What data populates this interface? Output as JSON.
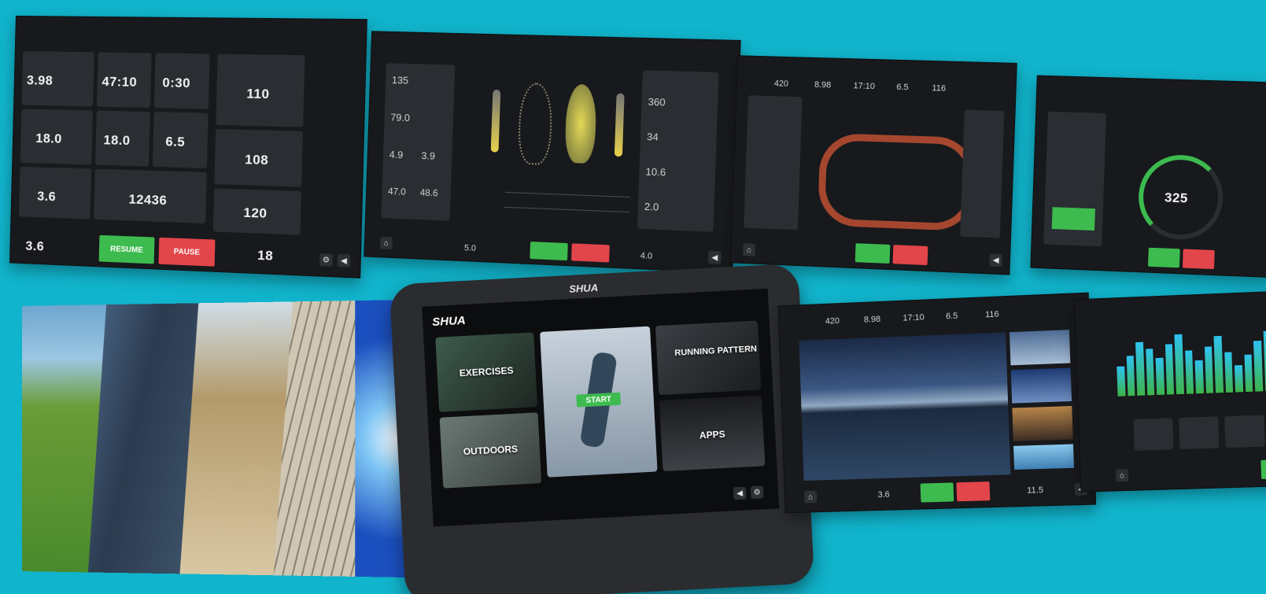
{
  "colors": {
    "background": "#10b4cc",
    "go_button": "#3dbb4f",
    "stop_button": "#e2454a",
    "panel": "#17191c"
  },
  "panel1": {
    "values": [
      "3.98",
      "47:10",
      "0:30",
      "110",
      "18.0",
      "18.0",
      "6.5",
      "108",
      "3.6",
      "12436",
      "120"
    ],
    "bottom_value_left": "3.6",
    "bottom_value_right": "18",
    "resume_label": "RESUME",
    "pause_label": "PAUSE"
  },
  "panel2": {
    "left_values": [
      "135",
      "79.0",
      "4.9",
      "3.9",
      "47.0",
      "48.6"
    ],
    "right_values": [
      "360",
      "34",
      "10.6",
      "2.0"
    ],
    "bottom_left": "5.0",
    "bottom_right": "4.0"
  },
  "panel3": {
    "stats": [
      "420",
      "8.98",
      "17:10",
      "6.5",
      "116"
    ]
  },
  "panel4": {
    "gauge_value": "325"
  },
  "device": {
    "brand": "SHUA",
    "cards": {
      "exercises": "EXERCISES",
      "running_pattern": "RUNNING PATTERN",
      "outdoors": "OUTDOORS",
      "apps": "APPS",
      "start": "START"
    }
  },
  "panel5": {
    "stats": [
      "420",
      "8.98",
      "17:10",
      "6.5",
      "116"
    ],
    "bottom_left": "3.6",
    "bottom_right": "11.5"
  },
  "panel6": {
    "bar_levels": [
      0.45,
      0.6,
      0.8,
      0.7,
      0.55,
      0.75,
      0.9,
      0.65,
      0.5,
      0.7,
      0.85,
      0.6,
      0.4,
      0.55,
      0.75,
      0.9
    ]
  }
}
